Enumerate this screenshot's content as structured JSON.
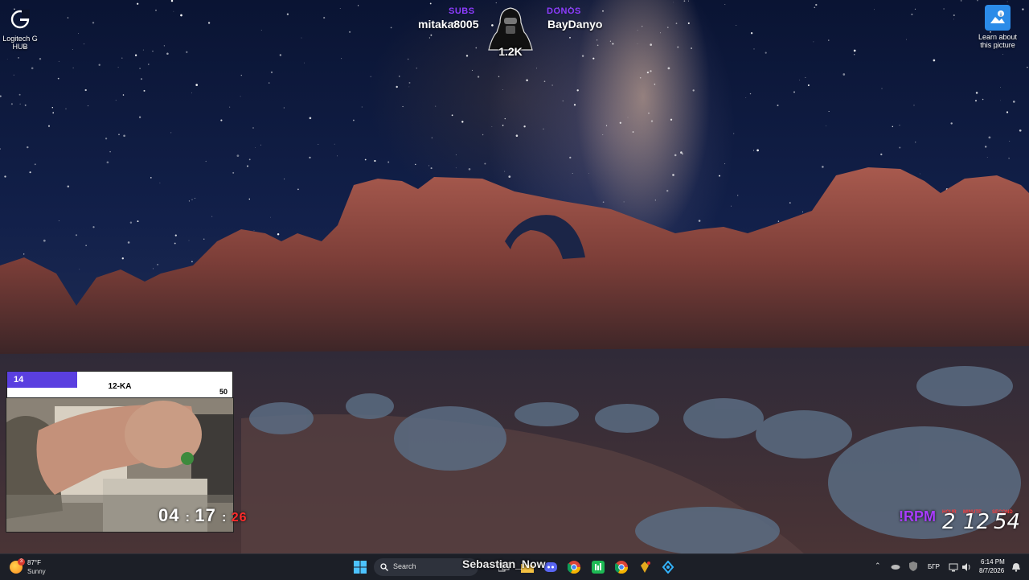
{
  "desktop": {
    "icons": [
      {
        "label": "Logitech G HUB",
        "icon": "logitech-g-hub-icon"
      },
      {
        "label": "Learn about this picture",
        "icon": "info-picture-icon"
      }
    ]
  },
  "stream_overlay": {
    "left_tag": "SUBS",
    "left_name": "mitaka8005",
    "right_tag": "DONOS",
    "right_name": "BayDanyo",
    "center_count": "1.2K",
    "level": {
      "current": "14",
      "label": "12-KA",
      "max": "50",
      "progress_fraction": 0.31
    },
    "timer": {
      "hours": "04",
      "minutes": "17",
      "seconds": "26"
    },
    "rpm": {
      "label": "!RPM",
      "sublabels": [
        "HOUR",
        "MINUTE",
        "SECOND"
      ],
      "values": [
        "2",
        "12",
        "54"
      ]
    },
    "taskbar_name_overlay": "Sebastian_Now"
  },
  "taskbar": {
    "weather": {
      "temp": "87°F",
      "condition": "Sunny",
      "badge": "3"
    },
    "search_placeholder": "Search",
    "apps": [
      "start-icon",
      "search-icon",
      "task-view-icon",
      "file-explorer-icon",
      "discord-icon",
      "chrome-icon",
      "app-green-icon",
      "chrome-icon",
      "game-icon",
      "app-blue-icon"
    ],
    "tray": {
      "language": "БГР",
      "time": "6:14 PM",
      "date": "8/7/2026"
    }
  },
  "colors": {
    "accent_purple": "#8e3cff",
    "level_fill": "#5a3fe0",
    "timer_red": "#ff2b2b"
  }
}
